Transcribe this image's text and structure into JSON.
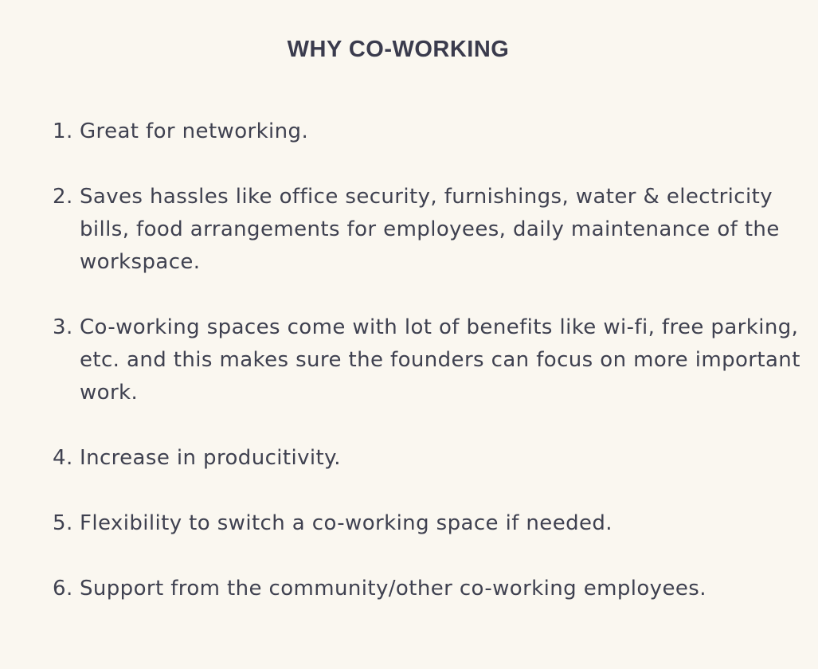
{
  "title": "WHY CO-WORKING",
  "items": [
    {
      "number": "1.",
      "text": "Great for networking."
    },
    {
      "number": "2.",
      "text": "Saves hassles like office security, furnishings, water & electricity bills, food arrangements for employees, daily maintenance of the workspace."
    },
    {
      "number": "3.",
      "text": "Co-working spaces come with lot of benefits like wi-fi, free parking, etc. and this makes sure the founders can focus on more important work."
    },
    {
      "number": "4.",
      "text": "Increase in producitivity."
    },
    {
      "number": "5.",
      "text": "Flexibility to switch a co-working space if needed."
    },
    {
      "number": "6.",
      "text": "Support from the community/other co-working employees."
    }
  ]
}
